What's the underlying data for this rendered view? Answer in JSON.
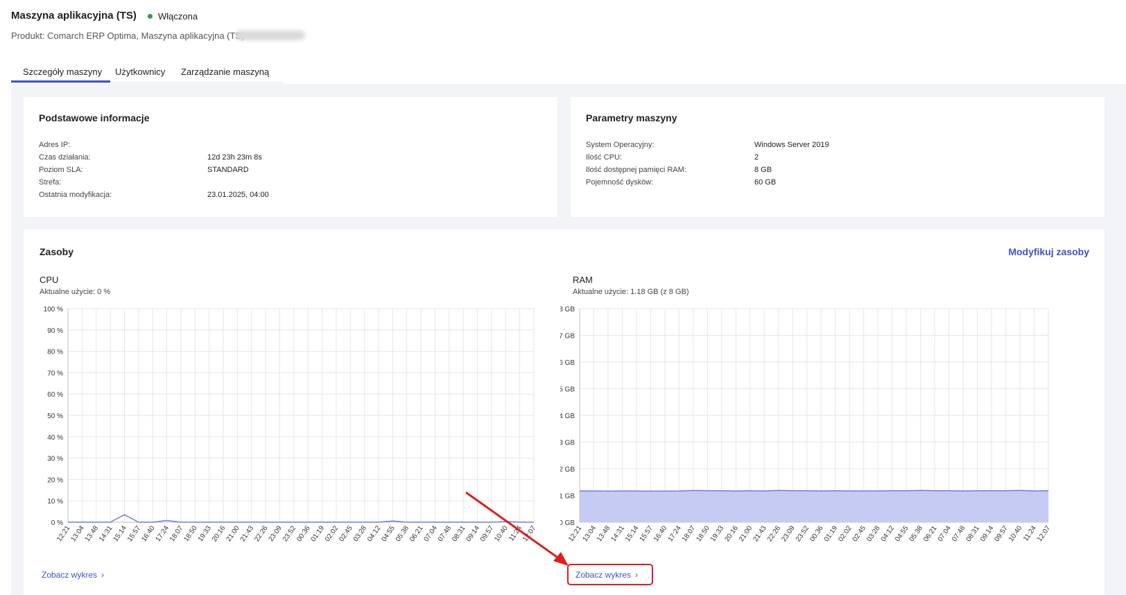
{
  "header": {
    "title": "Maszyna aplikacyjna (TS)",
    "status": "Włączona",
    "status_color": "#2e9e4a",
    "product": "Produkt: Comarch ERP Optima, Maszyna aplikacyjna (TS)"
  },
  "tabs": [
    {
      "label": "Szczegóły maszyny",
      "active": true
    },
    {
      "label": "Użytkownicy",
      "active": false
    },
    {
      "label": "Zarządzanie maszyną",
      "active": false
    }
  ],
  "basic_info": {
    "title": "Podstawowe informacje",
    "rows": [
      {
        "label": "Adres IP:",
        "value": ""
      },
      {
        "label": "Czas działania:",
        "value": "12d 23h 23m 8s"
      },
      {
        "label": "Poziom SLA:",
        "value": "STANDARD"
      },
      {
        "label": "Strefa:",
        "value": ""
      },
      {
        "label": "Ostatnia modyfikacja:",
        "value": "23.01.2025, 04:00"
      }
    ]
  },
  "machine_params": {
    "title": "Parametry maszyny",
    "rows": [
      {
        "label": "System Operacyjny:",
        "value": "Windows Server 2019"
      },
      {
        "label": "Ilość CPU:",
        "value": "2"
      },
      {
        "label": "Ilość dostępnej pamięci RAM:",
        "value": "8 GB"
      },
      {
        "label": "Pojemność dysków:",
        "value": "60 GB"
      }
    ]
  },
  "resources": {
    "title": "Zasoby",
    "modify_label": "Modyfikuj zasoby",
    "accent_color": "#3f51c8",
    "cpu": {
      "title": "CPU",
      "usage": "Aktualne użycie: 0 %",
      "see_chart": "Zobacz wykres"
    },
    "ram": {
      "title": "RAM",
      "usage": "Aktualne użycie: 1.18 GB (z 8 GB)",
      "see_chart": "Zobacz wykres",
      "highlighted": true
    }
  },
  "chart_data": [
    {
      "type": "line",
      "name": "CPU",
      "y_ticks": [
        "100 %",
        "90 %",
        "80 %",
        "70 %",
        "60 %",
        "50 %",
        "40 %",
        "30 %",
        "20 %",
        "10 %",
        "0 %"
      ],
      "ylim": [
        0,
        100
      ],
      "categories": [
        "12:21",
        "13:04",
        "13:48",
        "14:31",
        "15:14",
        "15:57",
        "16:40",
        "17:24",
        "18:07",
        "18:50",
        "19:33",
        "20:16",
        "21:00",
        "21:43",
        "22:26",
        "23:09",
        "23:52",
        "00:36",
        "01:19",
        "02:02",
        "02:45",
        "03:28",
        "04:12",
        "04:55",
        "05:38",
        "06:21",
        "07:04",
        "07:48",
        "08:31",
        "09:14",
        "09:57",
        "10:40",
        "11:24",
        "12:07"
      ],
      "series": [
        {
          "values": [
            0,
            0,
            0,
            0,
            3.5,
            0,
            0,
            0.8,
            0,
            0,
            0,
            0,
            0,
            0,
            0,
            0,
            0,
            0,
            0,
            0,
            0,
            0,
            0,
            0.6,
            0,
            0,
            0,
            0,
            0,
            0,
            0,
            0.3,
            0,
            0
          ]
        }
      ],
      "line_color": "#6b7fe0",
      "grid": true
    },
    {
      "type": "area",
      "name": "RAM",
      "y_ticks": [
        "8 GB",
        "7 GB",
        "6 GB",
        "5 GB",
        "4 GB",
        "3 GB",
        "2 GB",
        "1 GB",
        "0 GB"
      ],
      "ylim": [
        0,
        8
      ],
      "categories": [
        "12:21",
        "13:04",
        "13:48",
        "14:31",
        "15:14",
        "15:57",
        "16:40",
        "17:24",
        "18:07",
        "18:50",
        "19:33",
        "20:16",
        "21:00",
        "21:43",
        "22:26",
        "23:09",
        "23:52",
        "00:36",
        "01:19",
        "02:02",
        "02:45",
        "03:28",
        "04:12",
        "04:55",
        "05:38",
        "06:21",
        "07:04",
        "07:48",
        "08:31",
        "09:14",
        "09:57",
        "10:40",
        "11:24",
        "12:07"
      ],
      "series": [
        {
          "values": [
            1.17,
            1.17,
            1.16,
            1.17,
            1.17,
            1.16,
            1.16,
            1.17,
            1.19,
            1.18,
            1.18,
            1.17,
            1.18,
            1.17,
            1.19,
            1.18,
            1.18,
            1.17,
            1.18,
            1.17,
            1.17,
            1.17,
            1.18,
            1.18,
            1.19,
            1.18,
            1.18,
            1.17,
            1.18,
            1.18,
            1.18,
            1.19,
            1.17,
            1.18
          ]
        }
      ],
      "line_color": "#6b7fe0",
      "fill_color": "#c5cbf3",
      "grid": true
    }
  ]
}
